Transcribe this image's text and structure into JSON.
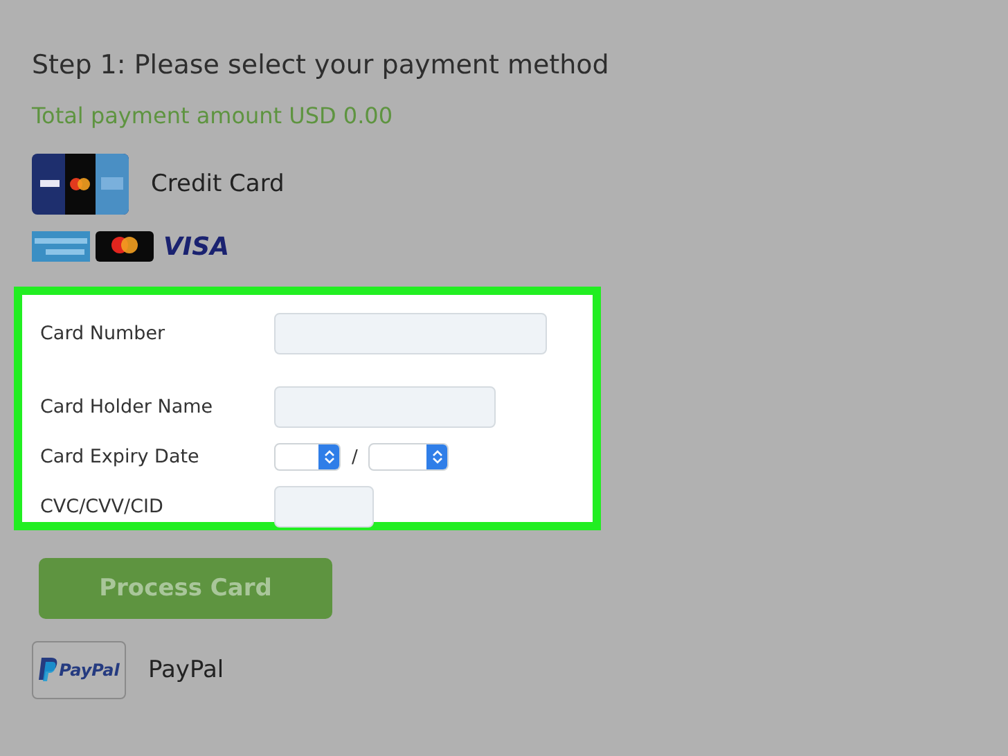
{
  "heading": "Step 1: Please select your payment method",
  "total": "Total payment amount USD 0.00",
  "credit_card": {
    "label": "Credit Card",
    "logos": [
      {
        "kind": "amex"
      },
      {
        "kind": "mastercard"
      },
      {
        "kind": "visa",
        "text": "VISA"
      }
    ]
  },
  "form": {
    "highlighted": true,
    "fields": [
      {
        "label": "Card Number",
        "kind": "text"
      },
      {
        "label": "Card Holder Name",
        "kind": "text"
      },
      {
        "label": "Card Expiry Date",
        "kind": "expiry",
        "separator": "/"
      },
      {
        "label": "CVC/CVV/CID",
        "kind": "text"
      }
    ]
  },
  "process_button": {
    "label": "Process Card",
    "disabled": true
  },
  "paypal": {
    "label": "PayPal",
    "logo_text": "PayPal"
  }
}
